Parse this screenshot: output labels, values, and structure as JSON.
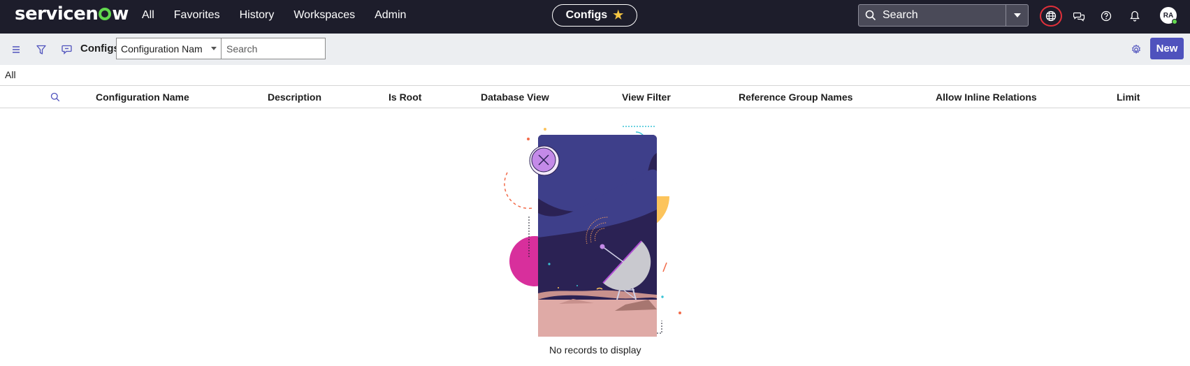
{
  "app": {
    "logo_text_a": "servicen",
    "logo_text_b": "w"
  },
  "nav": {
    "items": [
      "All",
      "Favorites",
      "History",
      "Workspaces",
      "Admin"
    ]
  },
  "context_pill": {
    "label": "Configs",
    "star": "★"
  },
  "global_search": {
    "placeholder": "Search"
  },
  "user": {
    "initials": "RA"
  },
  "toolbar": {
    "title": "Configs",
    "field_select": "Configuration Nam",
    "search_placeholder": "Search",
    "new_label": "New"
  },
  "breadcrumb": {
    "label": "All"
  },
  "table": {
    "columns": [
      "Configuration Name",
      "Description",
      "Is Root",
      "Database View",
      "View Filter",
      "Reference Group Names",
      "Allow Inline Relations",
      "Limit"
    ]
  },
  "empty_state": {
    "message": "No records to display"
  },
  "colors": {
    "topnav_bg": "#1d1d2b",
    "accent": "#4f52bd",
    "logo_o": "#62d84e",
    "alert_ring": "#e0303a"
  }
}
